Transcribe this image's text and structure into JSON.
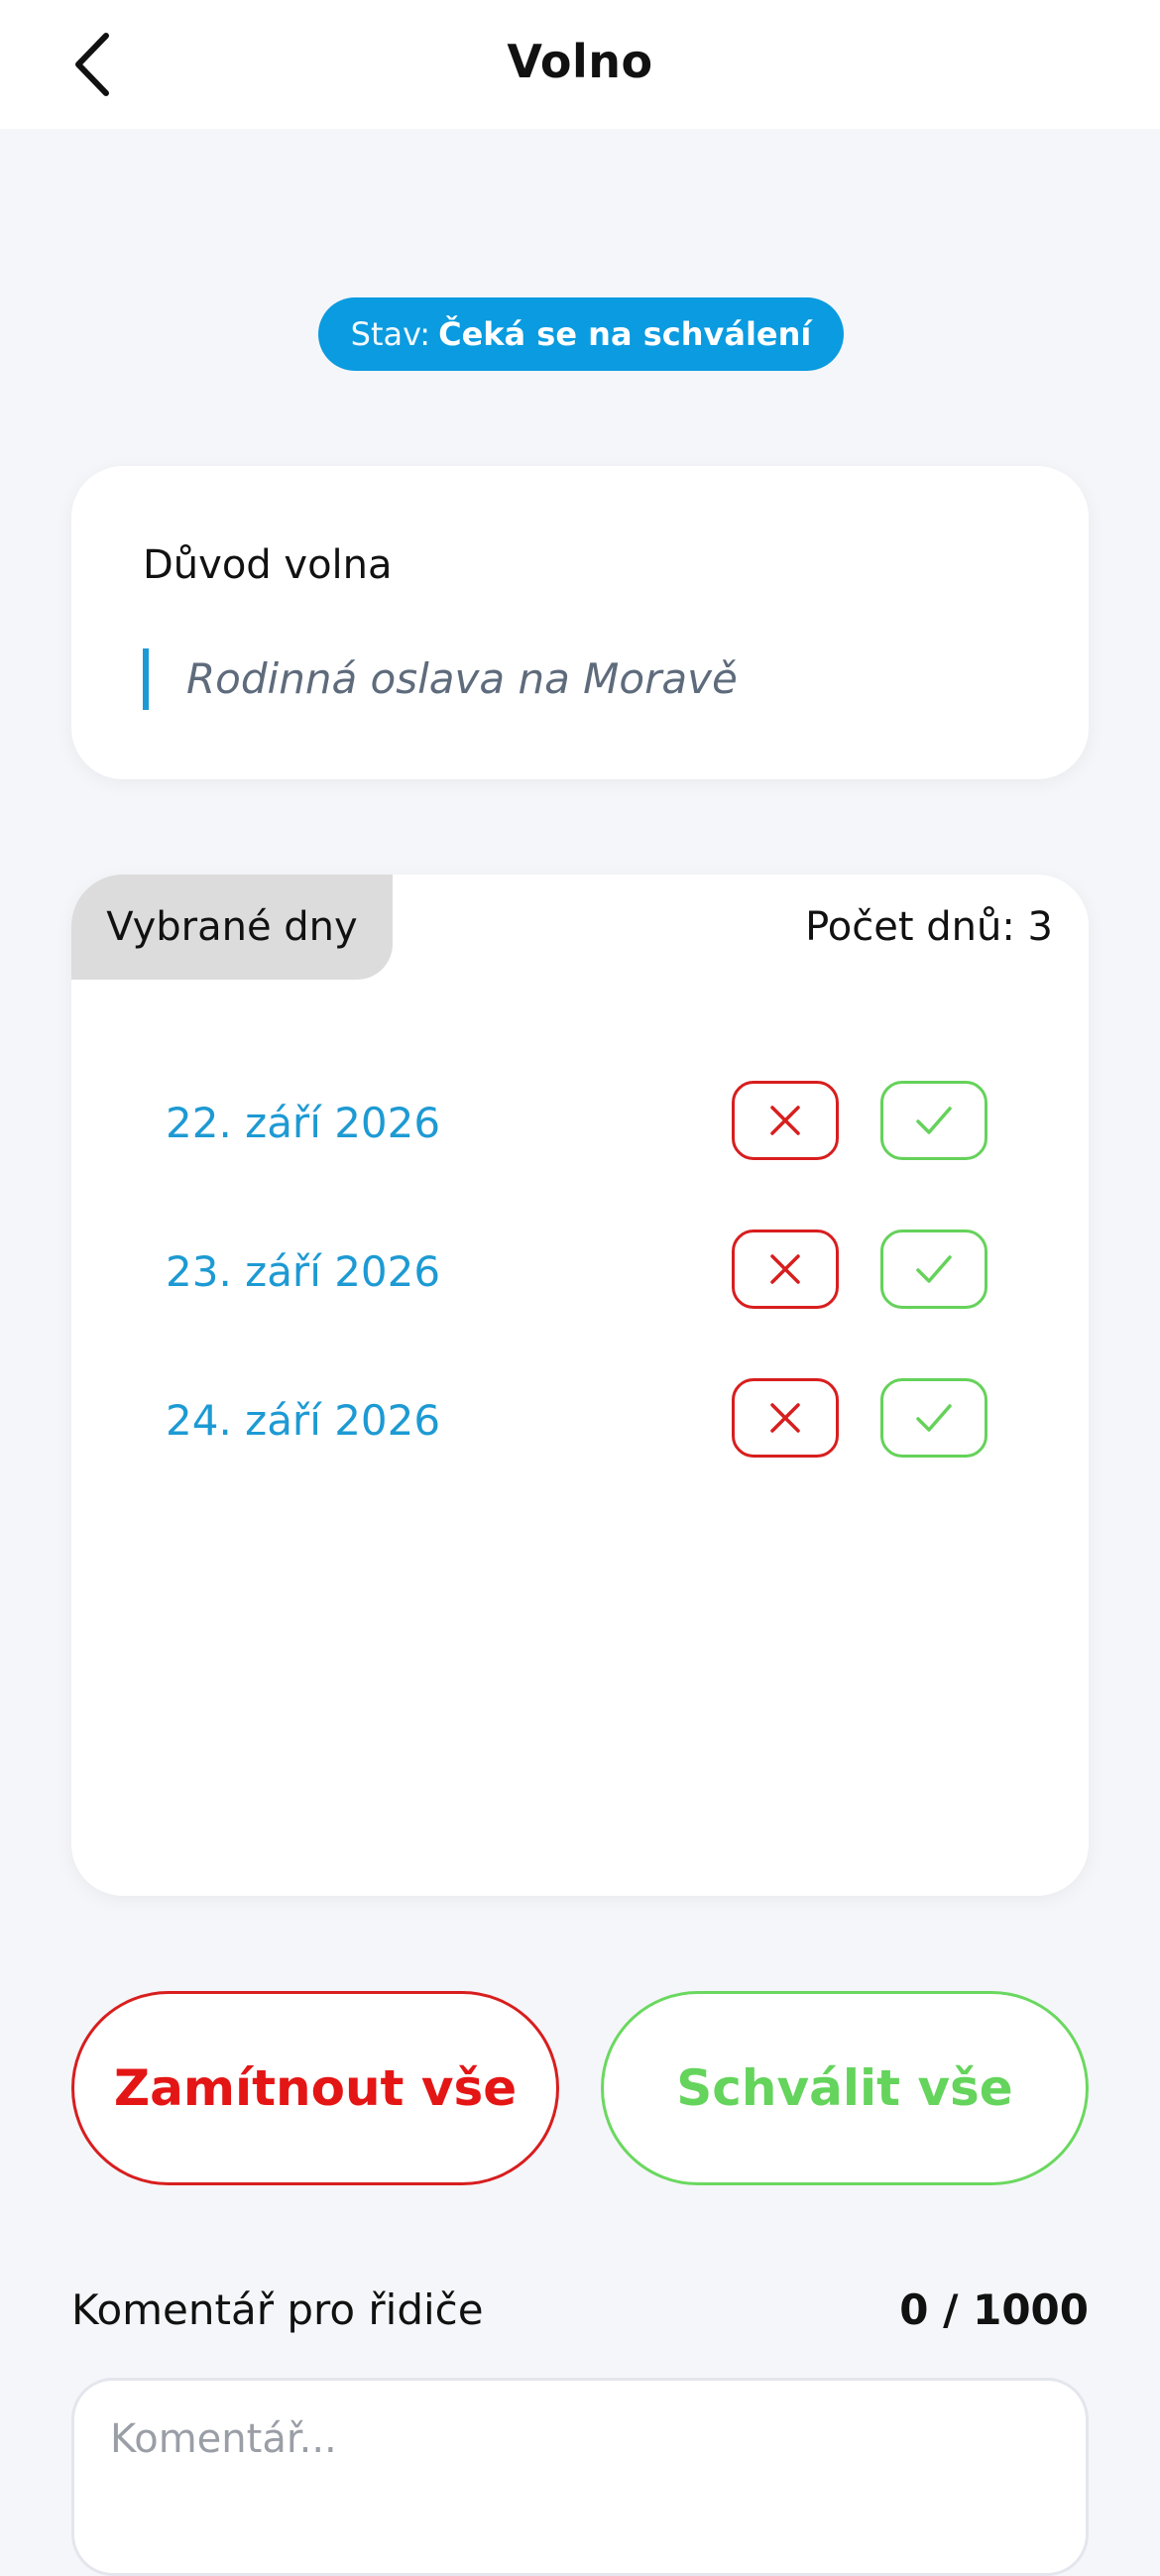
{
  "header": {
    "title": "Volno",
    "back_icon": "chevron-left-icon"
  },
  "status": {
    "prefix": "Stav:",
    "value": "Čeká se na schválení",
    "color": "#0a9be0"
  },
  "reason": {
    "title": "Důvod volna",
    "text": "Rodinná oslava na Moravě",
    "accent": "#1c9ad6"
  },
  "days": {
    "tab_label": "Vybrané dny",
    "count_label": "Počet dnů: 3",
    "items": [
      {
        "date": "22. září 2026"
      },
      {
        "date": "23. září 2026"
      },
      {
        "date": "24. září 2026"
      }
    ],
    "reject_icon": "close-icon",
    "approve_icon": "check-icon"
  },
  "actions": {
    "reject_all": "Zamítnout vše",
    "approve_all": "Schválit vše",
    "reject_color": "#e41515",
    "approve_color": "#64d45c"
  },
  "comment": {
    "label": "Komentář pro řidiče",
    "counter": "0 / 1000",
    "placeholder": "Komentář...",
    "value": ""
  }
}
